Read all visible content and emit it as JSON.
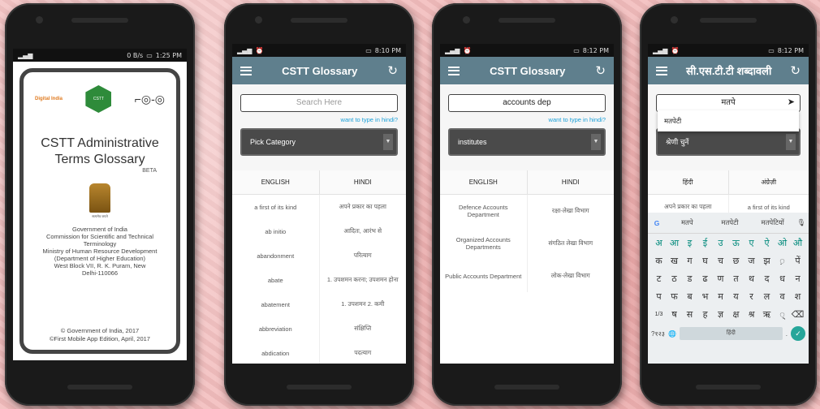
{
  "phone1": {
    "status_right": "0 B/s",
    "time": "1:25 PM",
    "logo_digital_india": "Digital India",
    "logo_glasses": "⌐◎-◎",
    "title_line1": "CSTT Administrative",
    "title_line2": "Terms Glossary",
    "beta": "BETA",
    "emblem_caption": "सत्यमेव जयते",
    "org_lines": [
      "Government of India",
      "Commission for Scientific and Technical",
      "Terminology",
      "Ministry of Human Resource Development",
      "(Department of Higher Education)",
      "West Block VII, R. K. Puram, New",
      "Delhi-110066"
    ],
    "copyright_line1": "© Government of India, 2017",
    "copyright_line2": "©First Mobile App Edition, April, 2017"
  },
  "phone2": {
    "time": "8:10 PM",
    "app_title": "CSTT Glossary",
    "search_placeholder": "Search Here",
    "hindi_link": "want to type in hindi?",
    "category": "Pick Category",
    "col_english": "ENGLISH",
    "col_hindi": "HINDI",
    "rows": [
      {
        "en": "a first of its kind",
        "hi": "अपने प्रकार का पहला"
      },
      {
        "en": "ab initio",
        "hi": "आदितः, आरंभ से"
      },
      {
        "en": "abandonment",
        "hi": "परित्याग"
      },
      {
        "en": "abate",
        "hi": "1. उपशमन करना; उपशमन होना"
      },
      {
        "en": "abatement",
        "hi": "1. उपशमन 2. कमी"
      },
      {
        "en": "abbreviation",
        "hi": "संक्षिप्ति"
      },
      {
        "en": "abdication",
        "hi": "पदत्याग"
      }
    ]
  },
  "phone3": {
    "time": "8:12 PM",
    "app_title": "CSTT Glossary",
    "search_value": "accounts dep",
    "hindi_link": "want to type in hindi?",
    "category": "institutes",
    "col_english": "ENGLISH",
    "col_hindi": "HINDI",
    "rows": [
      {
        "en": "Defence Accounts Department",
        "hi": "रक्षा-लेखा विभाग"
      },
      {
        "en": "Organized Accounts Departments",
        "hi": "संगठित लेखा विभाग"
      },
      {
        "en": "Public Accounts Department",
        "hi": "लोक-लेखा विभाग"
      }
    ]
  },
  "phone4": {
    "time": "8:12 PM",
    "app_title": "सी.एस.टी.टी शब्दावली",
    "search_value": "मतपे",
    "dropdown_item": "मतपेटी",
    "category": "श्रेणी चुनें",
    "col_hindi": "हिंदी",
    "col_english": "अंग्रेज़ी",
    "row": {
      "hi": "अपने प्रकार का पहला",
      "en": "a first of its kind"
    },
    "suggestions": [
      "मतपे",
      "मतपेटी",
      "मतपेटियों"
    ],
    "key_row1": [
      "अ",
      "आ",
      "इ",
      "ई",
      "उ",
      "ऊ",
      "ए",
      "ऐ",
      "ओ",
      "औ"
    ],
    "key_row2": [
      "क",
      "ख",
      "ग",
      "घ",
      "च",
      "छ",
      "ज",
      "झ",
      "़",
      "पें"
    ],
    "key_row3": [
      "ट",
      "ठ",
      "ड",
      "ढ",
      "ण",
      "त",
      "थ",
      "द",
      "ध",
      "न"
    ],
    "key_row4": [
      "प",
      "फ",
      "ब",
      "भ",
      "म",
      "य",
      "र",
      "ल",
      "व",
      "श"
    ],
    "key_row5": [
      "1/3",
      "ष",
      "स",
      "ह",
      "ज्ञ",
      "क्ष",
      "श्र",
      "ऋ",
      "्",
      "⌫"
    ],
    "key_symbols": "?१२३",
    "space_label": "हिंदी"
  }
}
